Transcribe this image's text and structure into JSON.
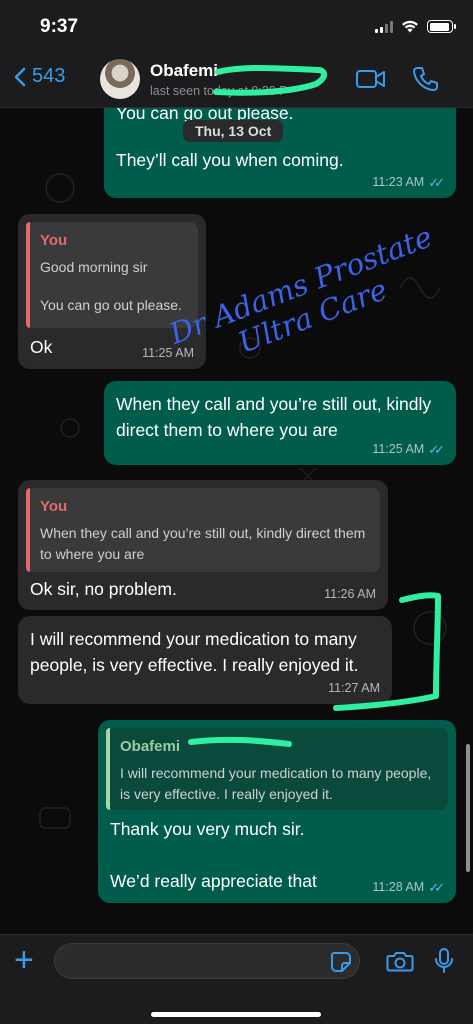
{
  "status_bar": {
    "time": "9:37",
    "battery_level": 0.92
  },
  "header": {
    "back_count": "543",
    "contact_name": "Obafemi",
    "last_seen": "last seen today at 9:20 P"
  },
  "chat": {
    "date_pill": "Thu, 13 Oct",
    "watermark_line1": "Dr Adams Prostate",
    "watermark_line2": "Ultra Care",
    "messages": [
      {
        "direction": "out",
        "text_partial": "You can go out please.",
        "text": "They’ll call you when coming.",
        "time": "11:23 AM"
      },
      {
        "direction": "in",
        "quote_author": "You",
        "quote_line1": "Good morning sir",
        "quote_line2": "You can go out please.",
        "text": "Ok",
        "time": "11:25 AM"
      },
      {
        "direction": "out",
        "text": "When they call and you’re still out, kindly direct them to where you are",
        "time": "11:25 AM"
      },
      {
        "direction": "in",
        "quote_author": "You",
        "quote_text": "When they call and you’re still out, kindly direct them to where you are",
        "text": "Ok sir, no problem.",
        "time": "11:26 AM"
      },
      {
        "direction": "in",
        "text": "I will recommend your medication to many people, is very effective. I really enjoyed it.",
        "time": "11:27 AM"
      },
      {
        "direction": "out",
        "quote_author": "Obafemi",
        "quote_text": "I will recommend your medication to many people, is very effective. I really enjoyed it.",
        "text_line1": "Thank you very much sir.",
        "text_line2": "We’d really appreciate that",
        "time": "11:28 AM"
      }
    ]
  },
  "input_bar": {
    "placeholder": ""
  },
  "colors": {
    "accent": "#3a9be8",
    "outgoing": "#005c4b",
    "incoming": "#2a2a2c",
    "read_ticks": "#53bdeb",
    "watermark": "#3a63e6",
    "annotation": "#2ff0a0"
  },
  "icons": [
    "back-chevron-icon",
    "video-call-icon",
    "phone-icon",
    "plus-icon",
    "sticker-icon",
    "camera-icon",
    "microphone-icon"
  ]
}
